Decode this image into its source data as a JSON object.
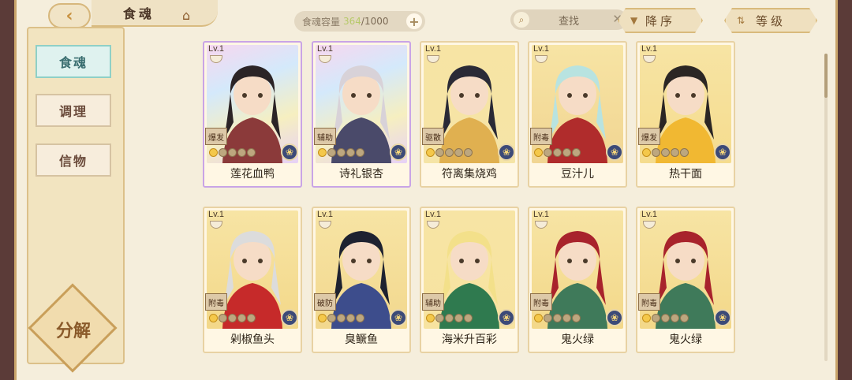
{
  "header": {
    "title": "食魂",
    "capacity_label": "食魂容量",
    "capacity_current": "364",
    "capacity_max": "/1000",
    "search_placeholder": "查找",
    "sort_desc_label": "降序",
    "sort_level_label": "等级"
  },
  "sidebar": {
    "tabs": [
      {
        "label": "食魂",
        "active": true
      },
      {
        "label": "调理",
        "active": false
      },
      {
        "label": "信物",
        "active": false
      }
    ],
    "decompose_label": "分解"
  },
  "cards": [
    {
      "level": "Lv.1",
      "role": "爆发",
      "name": "莲花血鸭",
      "stars_on": 1,
      "frame": "rainbow",
      "art_colors": [
        "#2b2426",
        "#8b3a3a",
        "#e7c39a"
      ]
    },
    {
      "level": "Lv.1",
      "role": "辅助",
      "name": "诗礼银杏",
      "stars_on": 1,
      "frame": "rainbow",
      "art_colors": [
        "#d8d2d8",
        "#4a4a6a",
        "#f0d98c"
      ]
    },
    {
      "level": "Lv.1",
      "role": "驱散",
      "name": "符离集烧鸡",
      "stars_on": 1,
      "frame": "gold",
      "art_colors": [
        "#2a2a36",
        "#e0b050",
        "#f5e4a6"
      ]
    },
    {
      "level": "Lv.1",
      "role": "附毒",
      "name": "豆汁儿",
      "stars_on": 1,
      "frame": "gold",
      "art_colors": [
        "#b8e3e0",
        "#b02c2c",
        "#f1d592"
      ]
    },
    {
      "level": "Lv.1",
      "role": "爆发",
      "name": "热干面",
      "stars_on": 1,
      "frame": "gold",
      "art_colors": [
        "#2b2624",
        "#f1b832",
        "#f5dc8e"
      ]
    },
    {
      "level": "Lv.1",
      "role": "附毒",
      "name": "剁椒鱼头",
      "stars_on": 1,
      "frame": "gold",
      "art_colors": [
        "#dcdcdc",
        "#c62a2a",
        "#f3d889"
      ]
    },
    {
      "level": "Lv.1",
      "role": "破防",
      "name": "臭鳜鱼",
      "stars_on": 1,
      "frame": "gold",
      "art_colors": [
        "#1e2230",
        "#3d4d8c",
        "#f2d88e"
      ]
    },
    {
      "level": "Lv.1",
      "role": "辅助",
      "name": "海米升百彩",
      "stars_on": 1,
      "frame": "gold",
      "art_colors": [
        "#f3e08a",
        "#2f7a4f",
        "#f7e3a0"
      ]
    },
    {
      "level": "Lv.1",
      "role": "附毒",
      "name": "鬼火绿",
      "stars_on": 1,
      "frame": "gold",
      "art_colors": [
        "#a8232c",
        "#3f7a5a",
        "#f3d889"
      ]
    },
    {
      "level": "Lv.1",
      "role": "附毒",
      "name": "鬼火绿",
      "stars_on": 1,
      "frame": "gold",
      "art_colors": [
        "#a8232c",
        "#3f7a5a",
        "#f3d889"
      ]
    }
  ],
  "colors": {
    "accent": "#c8913f",
    "active_tab": "#dff2ef",
    "capacity_highlight": "#b7c96a"
  }
}
